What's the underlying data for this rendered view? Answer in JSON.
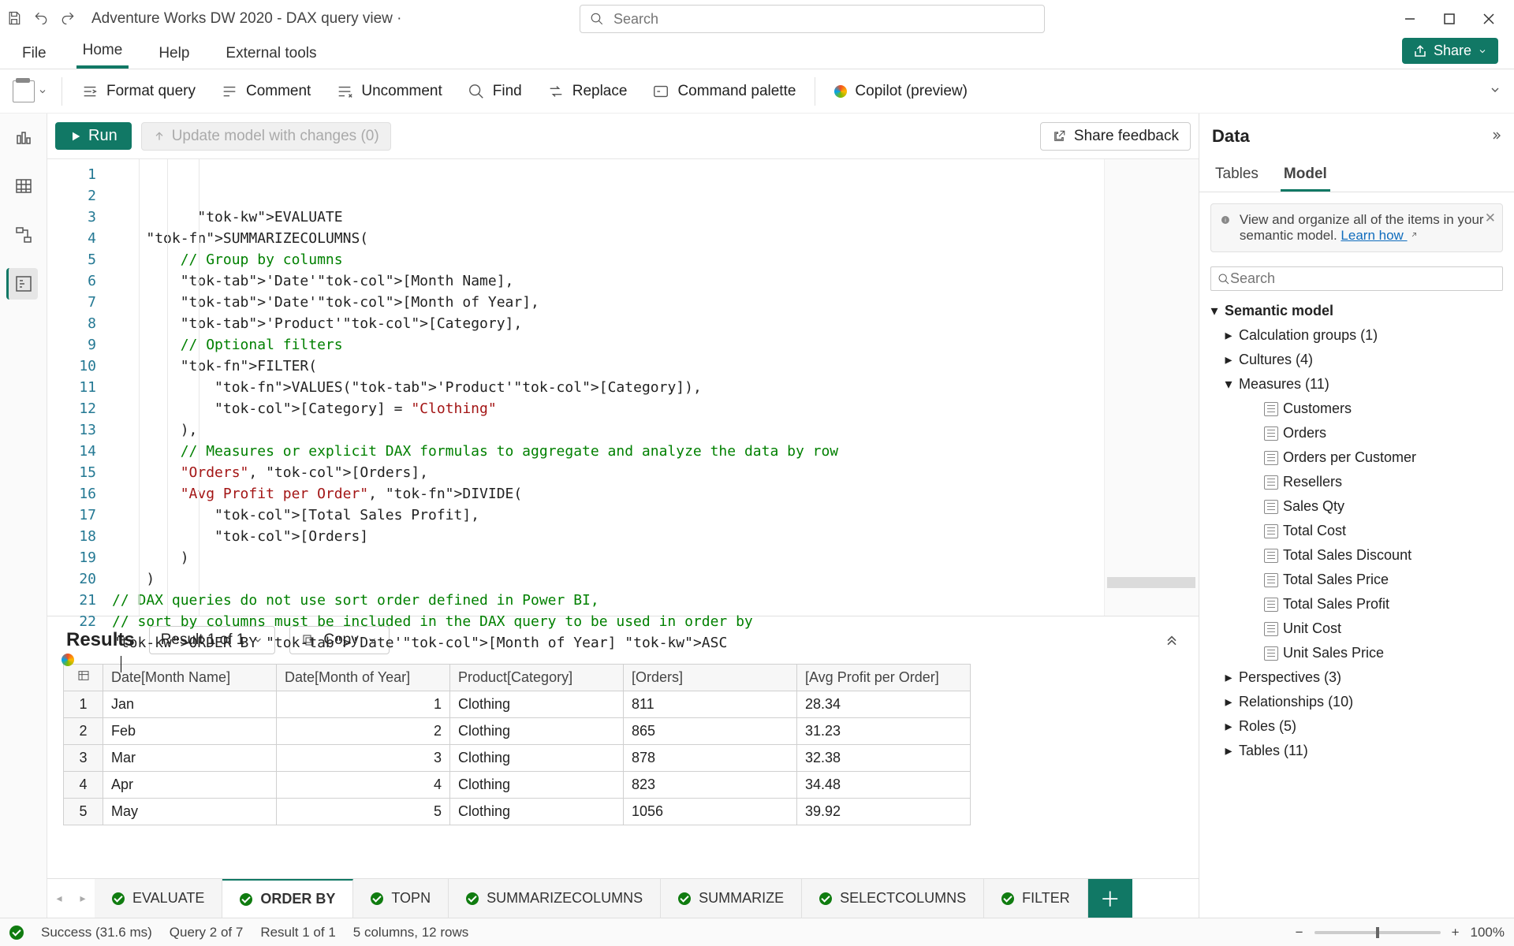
{
  "window": {
    "title": "Adventure Works DW 2020 - DAX query view ·",
    "search_placeholder": "Search"
  },
  "ribbon_tabs": [
    "File",
    "Home",
    "Help",
    "External tools"
  ],
  "ribbon_active": "Home",
  "share_label": "Share",
  "ribbon_buttons": {
    "paste": "Paste",
    "format": "Format query",
    "comment": "Comment",
    "uncomment": "Uncomment",
    "find": "Find",
    "replace": "Replace",
    "palette": "Command palette",
    "copilot": "Copilot (preview)"
  },
  "query_bar": {
    "run": "Run",
    "update": "Update model with changes (0)",
    "feedback": "Share feedback"
  },
  "code_lines": [
    "EVALUATE",
    "    SUMMARIZECOLUMNS(",
    "        // Group by columns",
    "        'Date'[Month Name],",
    "        'Date'[Month of Year],",
    "        'Product'[Category],",
    "        // Optional filters",
    "        FILTER(",
    "            VALUES('Product'[Category]),",
    "            [Category] = \"Clothing\"",
    "        ),",
    "        // Measures or explicit DAX formulas to aggregate and analyze the data by row",
    "        \"Orders\", [Orders],",
    "        \"Avg Profit per Order\", DIVIDE(",
    "            [Total Sales Profit],",
    "            [Orders]",
    "        )",
    "    )",
    "// DAX queries do not use sort order defined in Power BI,",
    "// sort by columns must be included in the DAX query to be used in order by",
    "ORDER BY 'Date'[Month of Year] ASC",
    ""
  ],
  "results": {
    "label": "Results",
    "picker": "Result 1 of 1",
    "copy": "Copy",
    "columns": [
      "Date[Month Name]",
      "Date[Month of Year]",
      "Product[Category]",
      "[Orders]",
      "[Avg Profit per Order]"
    ],
    "rows": [
      [
        "Jan",
        "1",
        "Clothing",
        "811",
        "28.34"
      ],
      [
        "Feb",
        "2",
        "Clothing",
        "865",
        "31.23"
      ],
      [
        "Mar",
        "3",
        "Clothing",
        "878",
        "32.38"
      ],
      [
        "Apr",
        "4",
        "Clothing",
        "823",
        "34.48"
      ],
      [
        "May",
        "5",
        "Clothing",
        "1056",
        "39.92"
      ]
    ]
  },
  "qtabs": [
    "EVALUATE",
    "ORDER BY",
    "TOPN",
    "SUMMARIZECOLUMNS",
    "SUMMARIZE",
    "SELECTCOLUMNS",
    "FILTER"
  ],
  "qtab_active": "ORDER BY",
  "data_pane": {
    "title": "Data",
    "tabs": [
      "Tables",
      "Model"
    ],
    "tab_active": "Model",
    "info_text": "View and organize all of the items in your semantic model. ",
    "info_link": "Learn how ",
    "search_placeholder": "Search",
    "tree_root": "Semantic model",
    "groups": [
      {
        "label": "Calculation groups (1)",
        "expand": ">"
      },
      {
        "label": "Cultures (4)",
        "expand": ">"
      },
      {
        "label": "Measures (11)",
        "expand": "v",
        "children": [
          "Customers",
          "Orders",
          "Orders per Customer",
          "Resellers",
          "Sales Qty",
          "Total Cost",
          "Total Sales Discount",
          "Total Sales Price",
          "Total Sales Profit",
          "Unit Cost",
          "Unit Sales Price"
        ]
      },
      {
        "label": "Perspectives (3)",
        "expand": ">"
      },
      {
        "label": "Relationships (10)",
        "expand": ">"
      },
      {
        "label": "Roles (5)",
        "expand": ">"
      },
      {
        "label": "Tables (11)",
        "expand": ">"
      }
    ]
  },
  "status": {
    "success": "Success (31.6 ms)",
    "query": "Query 2 of 7",
    "result": "Result 1 of 1",
    "shape": "5 columns, 12 rows",
    "zoom": "100%"
  }
}
